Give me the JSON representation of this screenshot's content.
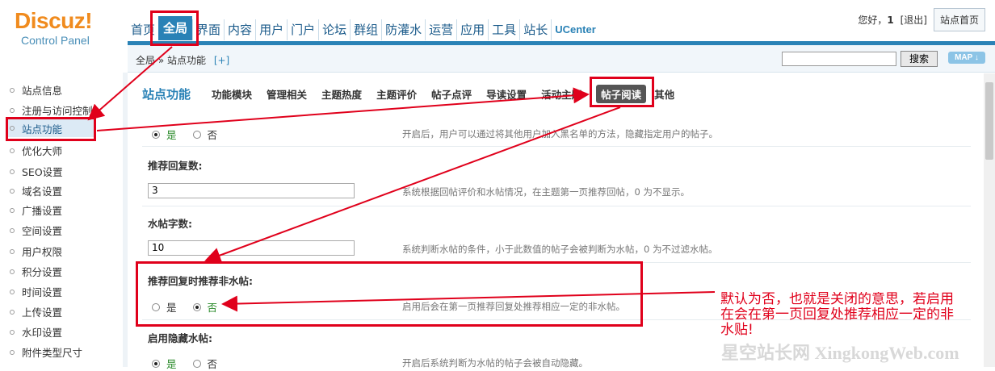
{
  "logo": {
    "brand": "Discuz!",
    "subtitle": "Control Panel"
  },
  "nav": {
    "items": [
      {
        "label": "首页",
        "active": false
      },
      {
        "label": "全局",
        "active": true
      },
      {
        "label": "界面",
        "active": false
      },
      {
        "label": "内容",
        "active": false
      },
      {
        "label": "用户",
        "active": false
      },
      {
        "label": "门户",
        "active": false
      },
      {
        "label": "论坛",
        "active": false
      },
      {
        "label": "群组",
        "active": false
      },
      {
        "label": "防灌水",
        "active": false
      },
      {
        "label": "运营",
        "active": false
      },
      {
        "label": "应用",
        "active": false
      },
      {
        "label": "工具",
        "active": false
      },
      {
        "label": "站长",
        "active": false
      },
      {
        "label": "UCenter",
        "active": false
      }
    ]
  },
  "user": {
    "greeting": "您好，",
    "name": "1",
    "logout": "[退出]",
    "site_home": "站点首页"
  },
  "breadcrumb": {
    "text": "全局 » 站点功能",
    "plus": "[+]"
  },
  "search": {
    "placeholder": "",
    "button": "搜索",
    "map": "MAP ↓"
  },
  "sidebar": {
    "items": [
      {
        "label": "站点信息"
      },
      {
        "label": "注册与访问控制"
      },
      {
        "label": "站点功能",
        "active": true
      },
      {
        "label": "优化大师"
      },
      {
        "label": "SEO设置"
      },
      {
        "label": "域名设置"
      },
      {
        "label": "广播设置"
      },
      {
        "label": "空间设置"
      },
      {
        "label": "用户权限"
      },
      {
        "label": "积分设置"
      },
      {
        "label": "时间设置"
      },
      {
        "label": "上传设置"
      },
      {
        "label": "水印设置"
      },
      {
        "label": "附件类型尺寸"
      }
    ]
  },
  "subnav": {
    "title": "站点功能",
    "tabs": [
      {
        "label": "功能模块"
      },
      {
        "label": "管理相关"
      },
      {
        "label": "主题热度"
      },
      {
        "label": "主题评价"
      },
      {
        "label": "帖子点评"
      },
      {
        "label": "导读设置"
      },
      {
        "label": "活动主题"
      },
      {
        "label": "帖子阅读",
        "active": true
      },
      {
        "label": "其他"
      }
    ]
  },
  "settings": {
    "row1": {
      "yes": "是",
      "no": "否",
      "value": "yes",
      "desc": "开启后，用户可以通过将其他用户加入黑名单的方法，隐藏指定用户的帖子。"
    },
    "row2": {
      "label": "推荐回复数:",
      "value": "3",
      "desc": "系统根据回帖评价和水帖情况，在主题第一页推荐回帖，0 为不显示。"
    },
    "row3": {
      "label": "水帖字数:",
      "value": "10",
      "desc": "系统判断水帖的条件，小于此数值的帖子会被判断为水帖，0 为不过滤水帖。"
    },
    "row4": {
      "label": "推荐回复时推荐非水帖:",
      "yes": "是",
      "no": "否",
      "value": "no",
      "desc": "启用后会在第一页推荐回复处推荐相应一定的非水帖。"
    },
    "row5": {
      "label": "启用隐藏水帖:",
      "yes": "是",
      "no": "否",
      "value": "yes",
      "desc": "开启后系统判断为水帖的帖子会被自动隐藏。"
    }
  },
  "annotation": {
    "note_line1": "默认为否，也就是关闭的意思，若启用",
    "note_line2": "在会在第一页回复处推荐相应一定的非",
    "note_line3": "水贴!",
    "color": "#e0001b"
  },
  "watermark": "星空站长网 XingkongWeb.com",
  "colors": {
    "accent": "#2a82b6",
    "logo": "#f08b1e",
    "active_option": "#2a8a2a"
  }
}
